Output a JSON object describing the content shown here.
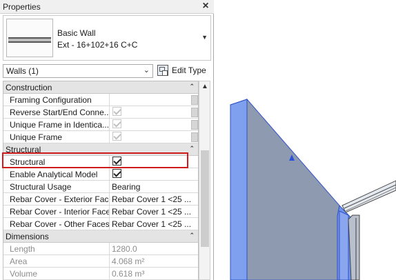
{
  "palette": {
    "title": "Properties",
    "type_selector": {
      "family": "Basic Wall",
      "type": "Ext - 16+102+16 C+C"
    },
    "filter": {
      "value": "Walls (1)"
    },
    "edit_type_label": "Edit Type"
  },
  "groups": [
    {
      "label": "Construction",
      "rows": [
        {
          "name": "Framing Configuration",
          "value": ""
        },
        {
          "name": "Reverse Start/End Conne...",
          "checkbox": true,
          "checked": true,
          "disabled": true
        },
        {
          "name": "Unique Frame in Identica...",
          "checkbox": true,
          "checked": true,
          "disabled": true
        },
        {
          "name": "Unique Frame",
          "checkbox": true,
          "checked": true,
          "disabled": true
        }
      ]
    },
    {
      "label": "Structural",
      "rows": [
        {
          "name": "Structural",
          "checkbox": true,
          "checked": true,
          "disabled": false,
          "highlighted": true
        },
        {
          "name": "Enable Analytical Model",
          "checkbox": true,
          "checked": true,
          "disabled": false
        },
        {
          "name": "Structural Usage",
          "value": "Bearing"
        },
        {
          "name": "Rebar Cover - Exterior Face",
          "value": "Rebar Cover 1 <25 ..."
        },
        {
          "name": "Rebar Cover - Interior Face",
          "value": "Rebar Cover 1 <25 ..."
        },
        {
          "name": "Rebar Cover - Other Faces",
          "value": "Rebar Cover 1 <25 ..."
        }
      ]
    },
    {
      "label": "Dimensions",
      "rows": [
        {
          "name": "Length",
          "value": "1280.0",
          "readonly": true
        },
        {
          "name": "Area",
          "value": "4.068 m²",
          "readonly": true
        },
        {
          "name": "Volume",
          "value": "0.618 m³",
          "readonly": true
        }
      ]
    }
  ],
  "colors": {
    "highlight": "#d11a1a",
    "wall_face": "#8e9ab0",
    "wall_selected": "#4a73e8"
  },
  "icons": [
    "close-icon",
    "dropdown-arrow-icon",
    "chevron-down-icon",
    "edit-type-icon",
    "collapse-icon",
    "scroll-up-icon",
    "checkbox-icon"
  ]
}
